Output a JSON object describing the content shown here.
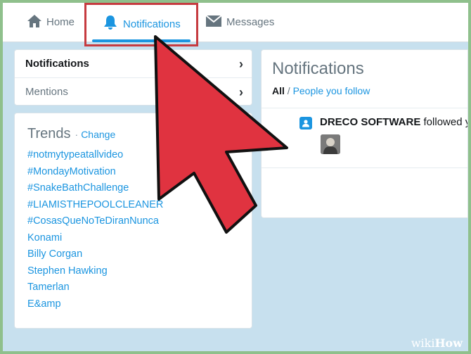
{
  "nav": {
    "home_label": "Home",
    "notifications_label": "Notifications",
    "messages_label": "Messages"
  },
  "sidebar": {
    "items": [
      {
        "label": "Notifications"
      },
      {
        "label": "Mentions"
      }
    ]
  },
  "trends": {
    "title": "Trends",
    "separator": "·",
    "change_label": "Change",
    "items": [
      "#notmytypeatallvideo",
      "#MondayMotivation",
      "#SnakeBathChallenge",
      "#LIAMISTHEPOOLCLEANER",
      "#CosasQueNoTeDiranNunca",
      "Konami",
      "Billy Corgan",
      "Stephen Hawking",
      "Tamerlan",
      "E&amp"
    ]
  },
  "main": {
    "title": "Notifications",
    "filter_all": "All",
    "filter_separator": " / ",
    "filter_people": "People you follow",
    "notification": {
      "name": "DRECO SOFTWARE",
      "action": "followed you"
    }
  },
  "watermark": {
    "wiki": "wiki",
    "how": "How"
  },
  "colors": {
    "accent": "#1b95e0",
    "highlight_box": "#c63b40",
    "cursor_fill": "#e03340",
    "background": "#c7e0ee"
  }
}
